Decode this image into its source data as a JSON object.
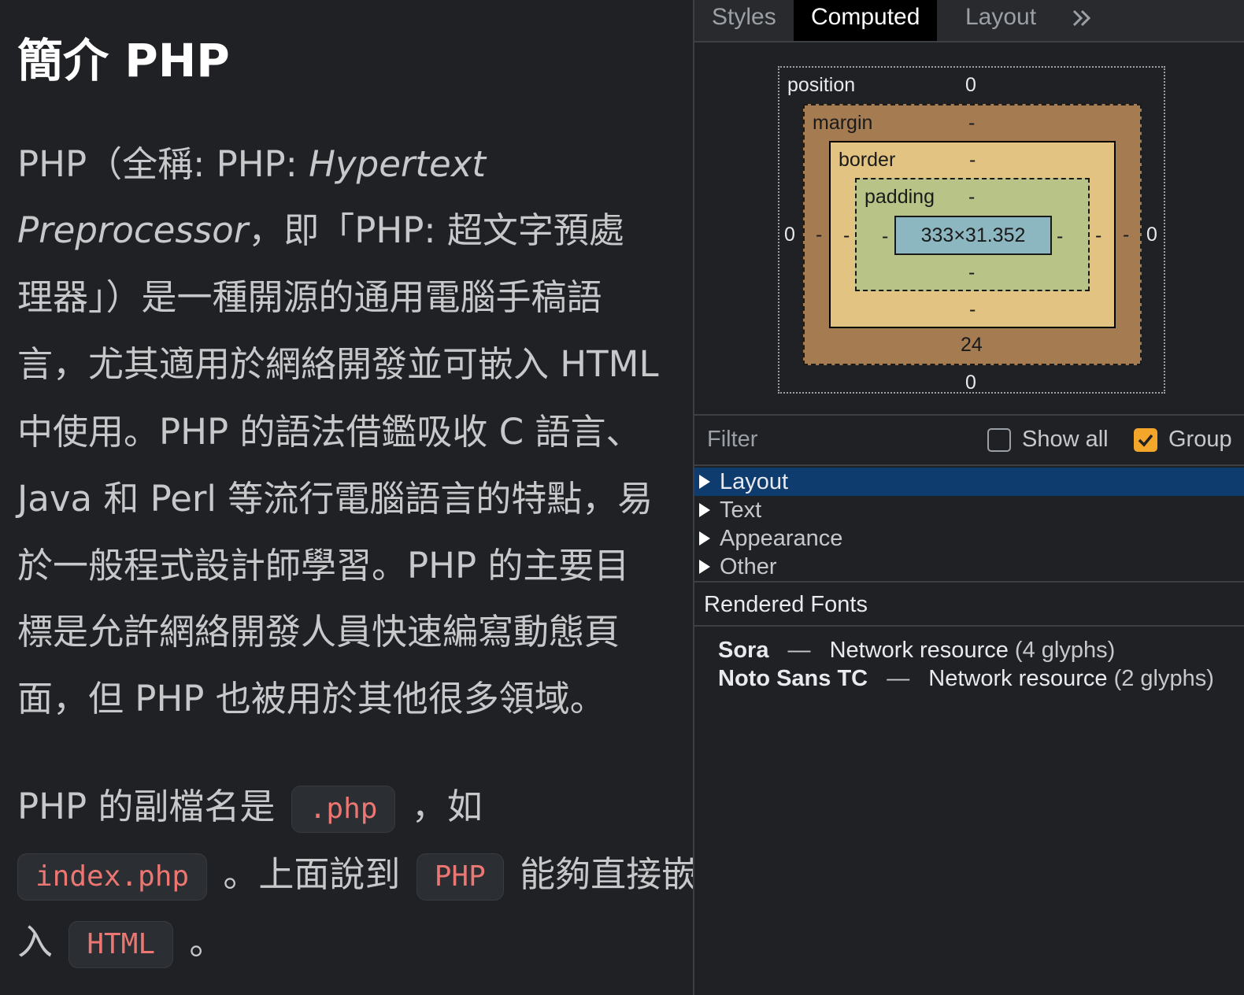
{
  "article": {
    "title": "簡介 PHP",
    "paragraph1": [
      {
        "a": "PHP（全稱: PHP: ",
        "i": "Hypertext"
      },
      {
        "i": "Preprocessor",
        "b": "，即「PHP: 超文字預處"
      },
      {
        "a": "理器」）是一種開源的通用電腦手稿語"
      },
      {
        "a": "言，尤其適用於網絡開發並可嵌入 HTML"
      },
      {
        "a": "中使用。PHP 的語法借鑑吸收 C 語言、"
      },
      {
        "a": "Java 和 Perl 等流行電腦語言的特點，易"
      },
      {
        "a": "於一般程式設計師學習。PHP 的主要目"
      },
      {
        "a": "標是允許網絡開發人員快速編寫動態頁"
      },
      {
        "a": "面，但 PHP 也被用於其他很多領域。"
      }
    ],
    "paragraph2": {
      "line1_a": "PHP 的副檔名是",
      "code1": ".php",
      "line1_b": "，如",
      "code2": "index.php",
      "line2_a": "。上面說到",
      "code3": "PHP",
      "line2_b": "能夠直接嵌",
      "line3_a": "入",
      "code4": "HTML",
      "line3_b": "。"
    }
  },
  "devtools": {
    "tabs": [
      "Styles",
      "Computed",
      "Layout"
    ],
    "active_tab": "Computed",
    "more_icon": "chevron-double-right-icon",
    "box_model": {
      "position_label": "position",
      "position_top": "0",
      "position_left": "0",
      "position_right": "0",
      "position_bottom": "0",
      "margin_label": "margin",
      "margin_top": "-",
      "margin_left": "-",
      "margin_right": "-",
      "margin_bottom": "24",
      "border_label": "border",
      "border_top": "-",
      "border_left": "-",
      "border_right": "-",
      "border_bottom": "-",
      "padding_label": "padding",
      "padding_top": "-",
      "padding_left": "-",
      "padding_right": "-",
      "padding_bottom": "-",
      "content_size": "333×31.352"
    },
    "filter": {
      "placeholder": "Filter",
      "show_all_label": "Show all",
      "show_all_checked": false,
      "group_label": "Group",
      "group_checked": true
    },
    "tree": [
      "Layout",
      "Text",
      "Appearance",
      "Other"
    ],
    "selected_tree_item": "Layout",
    "rendered_fonts_header": "Rendered Fonts",
    "fonts": [
      {
        "name": "Sora",
        "dash": "—",
        "source": "Network resource",
        "glyphs": "(4 glyphs)"
      },
      {
        "name": "Noto Sans TC",
        "dash": "—",
        "source": "Network resource",
        "glyphs": "(2 glyphs)"
      }
    ],
    "colors": {
      "margin": "#a57c52",
      "border": "#e3c381",
      "padding": "#b8c487",
      "content": "#8cb6c0",
      "selection": "#0f3c6e",
      "checkbox_accent": "#f3a62a",
      "code_text": "#ec7772"
    }
  }
}
